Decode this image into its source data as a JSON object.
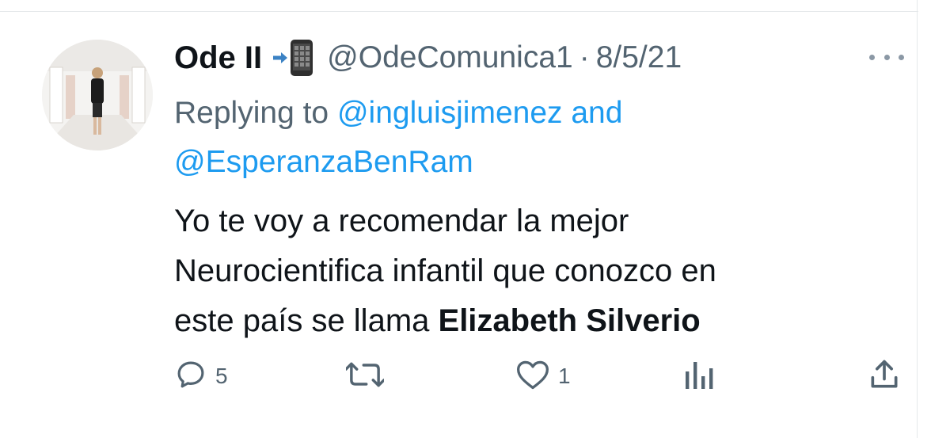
{
  "tweet": {
    "author_name": "Ode II",
    "handle": "@OdeComunica1",
    "separator": "·",
    "date": "8/5/21",
    "replying_prefix": "Replying to",
    "reply_mention_1": "@ingluisjimenez",
    "reply_conjunction": "and",
    "reply_mention_2": "@EsperanzaBenRam",
    "text_line_1": "Yo te voy a recomendar la mejor",
    "text_line_2": "Neurocientifica infantil que conozco en",
    "text_line_3_prefix": "este país se llama",
    "text_bold": "Elizabeth Silverio"
  },
  "actions": {
    "reply_count": "5",
    "like_count": "1"
  },
  "icons": [
    "mobile-arrow-emoji-icon",
    "more-icon",
    "reply-icon",
    "retweet-icon",
    "like-icon",
    "analytics-icon",
    "share-icon"
  ],
  "colors": {
    "text": "#0f1419",
    "secondary": "#536471",
    "link": "#1d9bf0",
    "divider": "#e6e9eb"
  }
}
